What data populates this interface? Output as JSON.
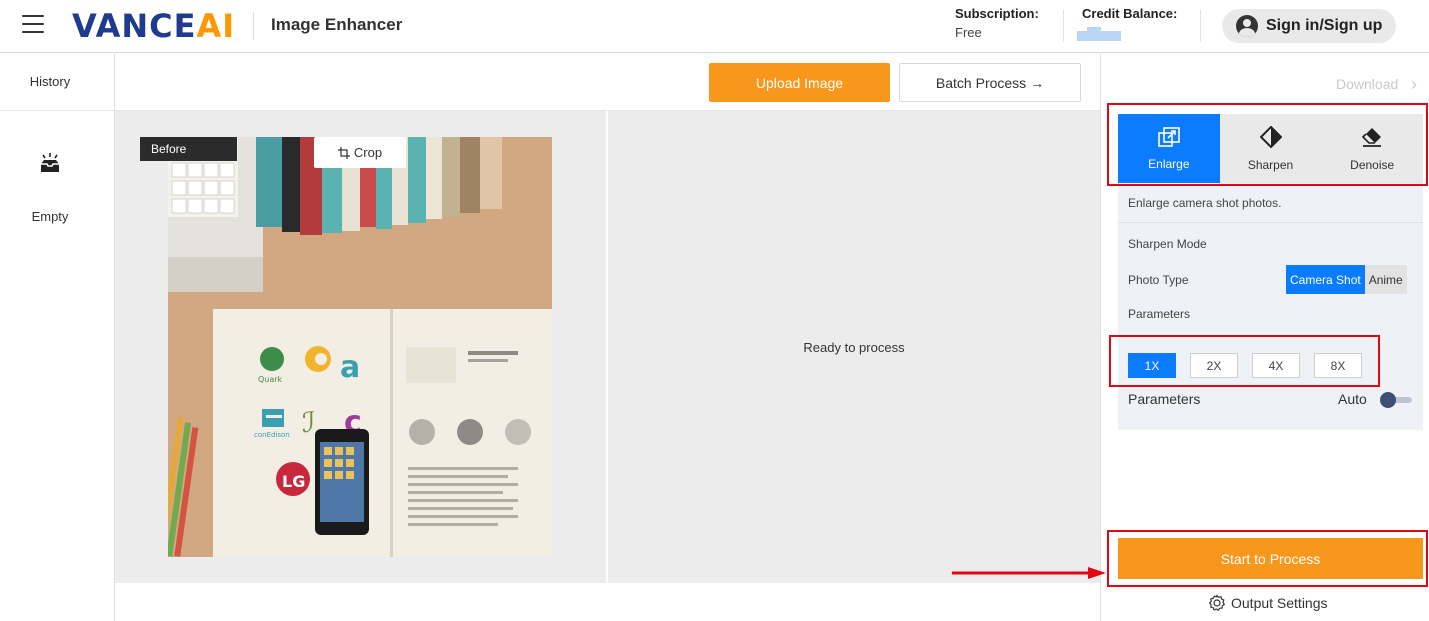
{
  "header": {
    "brand_main": "VANCE",
    "brand_accent": "AI",
    "app_title": "Image Enhancer",
    "subscription_label": "Subscription:",
    "subscription_value": "Free",
    "credit_label": "Credit Balance:",
    "sign_in_label": "Sign in/Sign up"
  },
  "sidebar": {
    "history_label": "History",
    "empty_label": "Empty"
  },
  "toolbar": {
    "upload_label": "Upload Image",
    "batch_label": "Batch Process →"
  },
  "canvas": {
    "before_badge": "Before",
    "crop_label": "Crop",
    "ready_text": "Ready to process"
  },
  "right_panel": {
    "download_label": "Download",
    "modes": [
      {
        "label": "Enlarge",
        "icon": "enlarge-icon",
        "active": true
      },
      {
        "label": "Sharpen",
        "icon": "sharpen-icon",
        "active": false
      },
      {
        "label": "Denoise",
        "icon": "denoise-icon",
        "active": false
      }
    ],
    "mode_description": "Enlarge camera shot photos.",
    "sharpen_mode_label": "Sharpen Mode",
    "photo_type_label": "Photo Type",
    "photo_types": [
      {
        "label": "Camera Shot",
        "active": true
      },
      {
        "label": "Anime",
        "active": false
      }
    ],
    "parameters_label": "Parameters",
    "scales": [
      {
        "label": "1X",
        "active": true
      },
      {
        "label": "2X",
        "active": false
      },
      {
        "label": "4X",
        "active": false
      },
      {
        "label": "8X",
        "active": false
      }
    ],
    "parameters_label_2": "Parameters",
    "auto_label": "Auto",
    "auto_enabled": false,
    "start_label": "Start to Process",
    "output_settings_label": "Output Settings"
  },
  "colors": {
    "accent_orange": "#f7981d",
    "accent_blue": "#0b7bff",
    "brand_navy": "#1f3b8f",
    "annotation_red": "#e30613"
  }
}
